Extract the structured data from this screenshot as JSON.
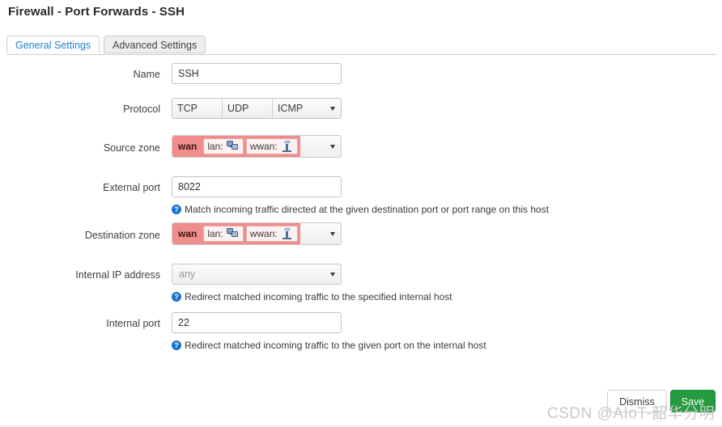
{
  "page": {
    "title": "Firewall - Port Forwards - SSH"
  },
  "tabs": [
    {
      "label": "General Settings",
      "active": true
    },
    {
      "label": "Advanced Settings",
      "active": false
    }
  ],
  "form": {
    "name": {
      "label": "Name",
      "value": "SSH"
    },
    "protocol": {
      "label": "Protocol",
      "options": [
        "TCP",
        "UDP",
        "ICMP"
      ]
    },
    "source_zone": {
      "label": "Source zone",
      "selected": "wan",
      "options": [
        {
          "label": "lan:",
          "icon": "lan-network-icon"
        },
        {
          "label": "wwan:",
          "icon": "wireless-antenna-icon"
        }
      ]
    },
    "external_port": {
      "label": "External port",
      "value": "8022",
      "help": "Match incoming traffic directed at the given destination port or port range on this host"
    },
    "destination_zone": {
      "label": "Destination zone",
      "selected": "wan",
      "options": [
        {
          "label": "lan:",
          "icon": "lan-network-icon"
        },
        {
          "label": "wwan:",
          "icon": "wireless-antenna-icon"
        }
      ]
    },
    "internal_ip": {
      "label": "Internal IP address",
      "value": "any",
      "help": "Redirect matched incoming traffic to the specified internal host"
    },
    "internal_port": {
      "label": "Internal port",
      "value": "22",
      "help": "Redirect matched incoming traffic to the given port on the internal host"
    }
  },
  "footer": {
    "dismiss_label": "Dismiss",
    "save_label": "Save"
  },
  "watermark": {
    "text": "CSDN @AIoT-韶华分明"
  },
  "colors": {
    "accent_blue": "#1f7fd6",
    "help_blue": "#1874cd",
    "zone_pink": "#f08d8d",
    "save_green": "#249b3e"
  }
}
